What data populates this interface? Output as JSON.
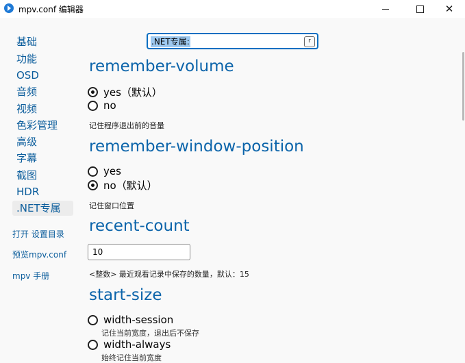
{
  "window": {
    "title": "mpv.conf 编辑器"
  },
  "sidebar": {
    "items": [
      {
        "label": "基础"
      },
      {
        "label": "功能"
      },
      {
        "label": "OSD"
      },
      {
        "label": "音频"
      },
      {
        "label": "视频"
      },
      {
        "label": "色彩管理"
      },
      {
        "label": "高级"
      },
      {
        "label": "字幕"
      },
      {
        "label": "截图"
      },
      {
        "label": "HDR"
      },
      {
        "label": ".NET专属",
        "selected": true
      }
    ],
    "links": [
      {
        "label": "打开 设置目录"
      },
      {
        "label": "预览mpv.conf"
      },
      {
        "label": "mpv 手册"
      }
    ]
  },
  "search": {
    "value": ".NET专属:",
    "regex_toggle": "r"
  },
  "sections": {
    "remember_volume": {
      "title": "remember-volume",
      "options": [
        {
          "label": "yes（默认）",
          "checked": true
        },
        {
          "label": "no",
          "checked": false
        }
      ],
      "description": "记住程序退出前的音量"
    },
    "remember_window_position": {
      "title": "remember-window-position",
      "options": [
        {
          "label": "yes",
          "checked": false
        },
        {
          "label": "no（默认）",
          "checked": true
        }
      ],
      "description": "记住窗口位置"
    },
    "recent_count": {
      "title": "recent-count",
      "value": "10",
      "description": "<整数> 最近观看记录中保存的数量，默认：15"
    },
    "start_size": {
      "title": "start-size",
      "options": [
        {
          "label": "width-session",
          "checked": false,
          "description": "记住当前宽度，退出后不保存"
        },
        {
          "label": "width-always",
          "checked": false,
          "description": "始终记住当前宽度"
        }
      ]
    }
  }
}
